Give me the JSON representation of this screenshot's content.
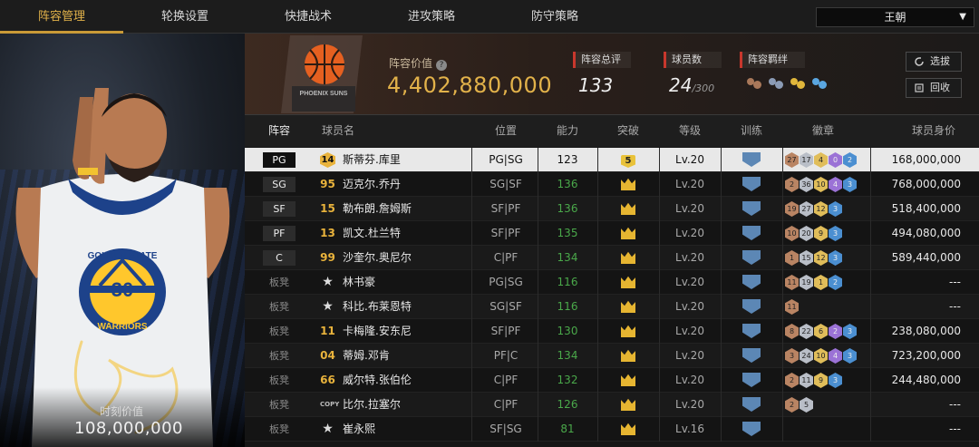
{
  "nav": {
    "tabs": [
      "阵容管理",
      "轮换设置",
      "快捷战术",
      "进攻策略",
      "防守策略"
    ],
    "active_tab": 0,
    "team_select": "王朝"
  },
  "portrait": {
    "jersey_number": "30",
    "jersey_text": "GOLDEN STATE",
    "jersey_team": "WARRIORS",
    "value_label": "时刻价值",
    "value": "108,000,000"
  },
  "header": {
    "team_logo_text": "PHOENIX SUNS",
    "lineup_value_label": "阵容价值",
    "lineup_value": "4,402,880,000",
    "stats": {
      "overall_label": "阵容总评",
      "overall": "133",
      "players_label": "球员数",
      "players_count": "24",
      "players_max": "/300",
      "bonds_label": "阵容羁绊"
    },
    "buttons": {
      "select": "选拔",
      "recycle": "回收"
    }
  },
  "table": {
    "columns": [
      "阵容",
      "球员名",
      "位置",
      "能力",
      "突破",
      "等级",
      "训练",
      "徽章",
      "球员身价"
    ],
    "rows": [
      {
        "slot": "PG",
        "num": "14",
        "num_style": "gold",
        "name": "斯蒂芬.库里",
        "pos": "PG|SG",
        "ability": "123",
        "breakthrough": "5",
        "level": "Lv.20",
        "badges": [
          [
            "27",
            "bronze"
          ],
          [
            "17",
            "silver"
          ],
          [
            "4",
            "gold"
          ],
          [
            "0",
            "purple"
          ],
          [
            "2",
            "blue"
          ]
        ],
        "salary": "168,000,000",
        "selected": true
      },
      {
        "slot": "SG",
        "num": "95",
        "num_style": "tag",
        "name": "迈克尔.乔丹",
        "pos": "SG|SF",
        "ability": "136",
        "breakthrough": "crown",
        "level": "Lv.20",
        "badges": [
          [
            "2",
            "bronze"
          ],
          [
            "36",
            "silver"
          ],
          [
            "10",
            "gold"
          ],
          [
            "4",
            "purple"
          ],
          [
            "3",
            "blue"
          ]
        ],
        "salary": "768,000,000"
      },
      {
        "slot": "SF",
        "num": "15",
        "num_style": "tag",
        "name": "勒布朗.詹姆斯",
        "pos": "SF|PF",
        "ability": "136",
        "breakthrough": "crown",
        "level": "Lv.20",
        "badges": [
          [
            "19",
            "bronze"
          ],
          [
            "27",
            "silver"
          ],
          [
            "12",
            "gold"
          ],
          [
            "3",
            "blue"
          ]
        ],
        "salary": "518,400,000"
      },
      {
        "slot": "PF",
        "num": "13",
        "num_style": "tag",
        "name": "凯文.杜兰特",
        "pos": "SF|PF",
        "ability": "135",
        "breakthrough": "crown",
        "level": "Lv.20",
        "badges": [
          [
            "10",
            "bronze"
          ],
          [
            "20",
            "silver"
          ],
          [
            "9",
            "gold"
          ],
          [
            "3",
            "blue"
          ]
        ],
        "salary": "494,080,000"
      },
      {
        "slot": "C",
        "num": "99",
        "num_style": "tag",
        "name": "沙奎尔.奥尼尔",
        "pos": "C|PF",
        "ability": "134",
        "breakthrough": "crown",
        "level": "Lv.20",
        "badges": [
          [
            "1",
            "bronze"
          ],
          [
            "15",
            "silver"
          ],
          [
            "12",
            "gold"
          ],
          [
            "3",
            "blue"
          ]
        ],
        "salary": "589,440,000"
      },
      {
        "slot": "板凳",
        "num": "★",
        "num_style": "star",
        "name": "林书豪",
        "pos": "PG|SG",
        "ability": "116",
        "breakthrough": "crown",
        "level": "Lv.20",
        "badges": [
          [
            "11",
            "bronze"
          ],
          [
            "19",
            "silver"
          ],
          [
            "1",
            "gold"
          ],
          [
            "2",
            "blue"
          ]
        ],
        "salary": "---"
      },
      {
        "slot": "板凳",
        "num": "★",
        "num_style": "star",
        "name": "科比.布莱恩特",
        "pos": "SG|SF",
        "ability": "116",
        "breakthrough": "crown",
        "level": "Lv.20",
        "badges": [
          [
            "11",
            "bronze"
          ]
        ],
        "salary": "---"
      },
      {
        "slot": "板凳",
        "num": "11",
        "num_style": "tag",
        "name": "卡梅隆.安东尼",
        "pos": "SF|PF",
        "ability": "130",
        "breakthrough": "crown",
        "level": "Lv.20",
        "badges": [
          [
            "8",
            "bronze"
          ],
          [
            "22",
            "silver"
          ],
          [
            "6",
            "gold"
          ],
          [
            "2",
            "purple"
          ],
          [
            "3",
            "blue"
          ]
        ],
        "salary": "238,080,000"
      },
      {
        "slot": "板凳",
        "num": "04",
        "num_style": "tag",
        "name": "蒂姆.邓肯",
        "pos": "PF|C",
        "ability": "134",
        "breakthrough": "crown",
        "level": "Lv.20",
        "badges": [
          [
            "3",
            "bronze"
          ],
          [
            "24",
            "silver"
          ],
          [
            "10",
            "gold"
          ],
          [
            "4",
            "purple"
          ],
          [
            "3",
            "blue"
          ]
        ],
        "salary": "723,200,000"
      },
      {
        "slot": "板凳",
        "num": "66",
        "num_style": "tag",
        "name": "威尔特.张伯伦",
        "pos": "C|PF",
        "ability": "132",
        "breakthrough": "crown",
        "level": "Lv.20",
        "badges": [
          [
            "2",
            "bronze"
          ],
          [
            "11",
            "silver"
          ],
          [
            "9",
            "gold"
          ],
          [
            "3",
            "blue"
          ]
        ],
        "salary": "244,480,000"
      },
      {
        "slot": "板凳",
        "num": "COPY",
        "num_style": "copy",
        "name": "比尔.拉塞尔",
        "pos": "C|PF",
        "ability": "126",
        "breakthrough": "crown",
        "level": "Lv.20",
        "badges": [
          [
            "2",
            "bronze"
          ],
          [
            "5",
            "silver"
          ]
        ],
        "salary": "---"
      },
      {
        "slot": "板凳",
        "num": "★",
        "num_style": "star",
        "name": "崔永熙",
        "pos": "SF|SG",
        "ability": "81",
        "breakthrough": "crown",
        "level": "Lv.16",
        "badges": [],
        "salary": "---"
      }
    ]
  }
}
